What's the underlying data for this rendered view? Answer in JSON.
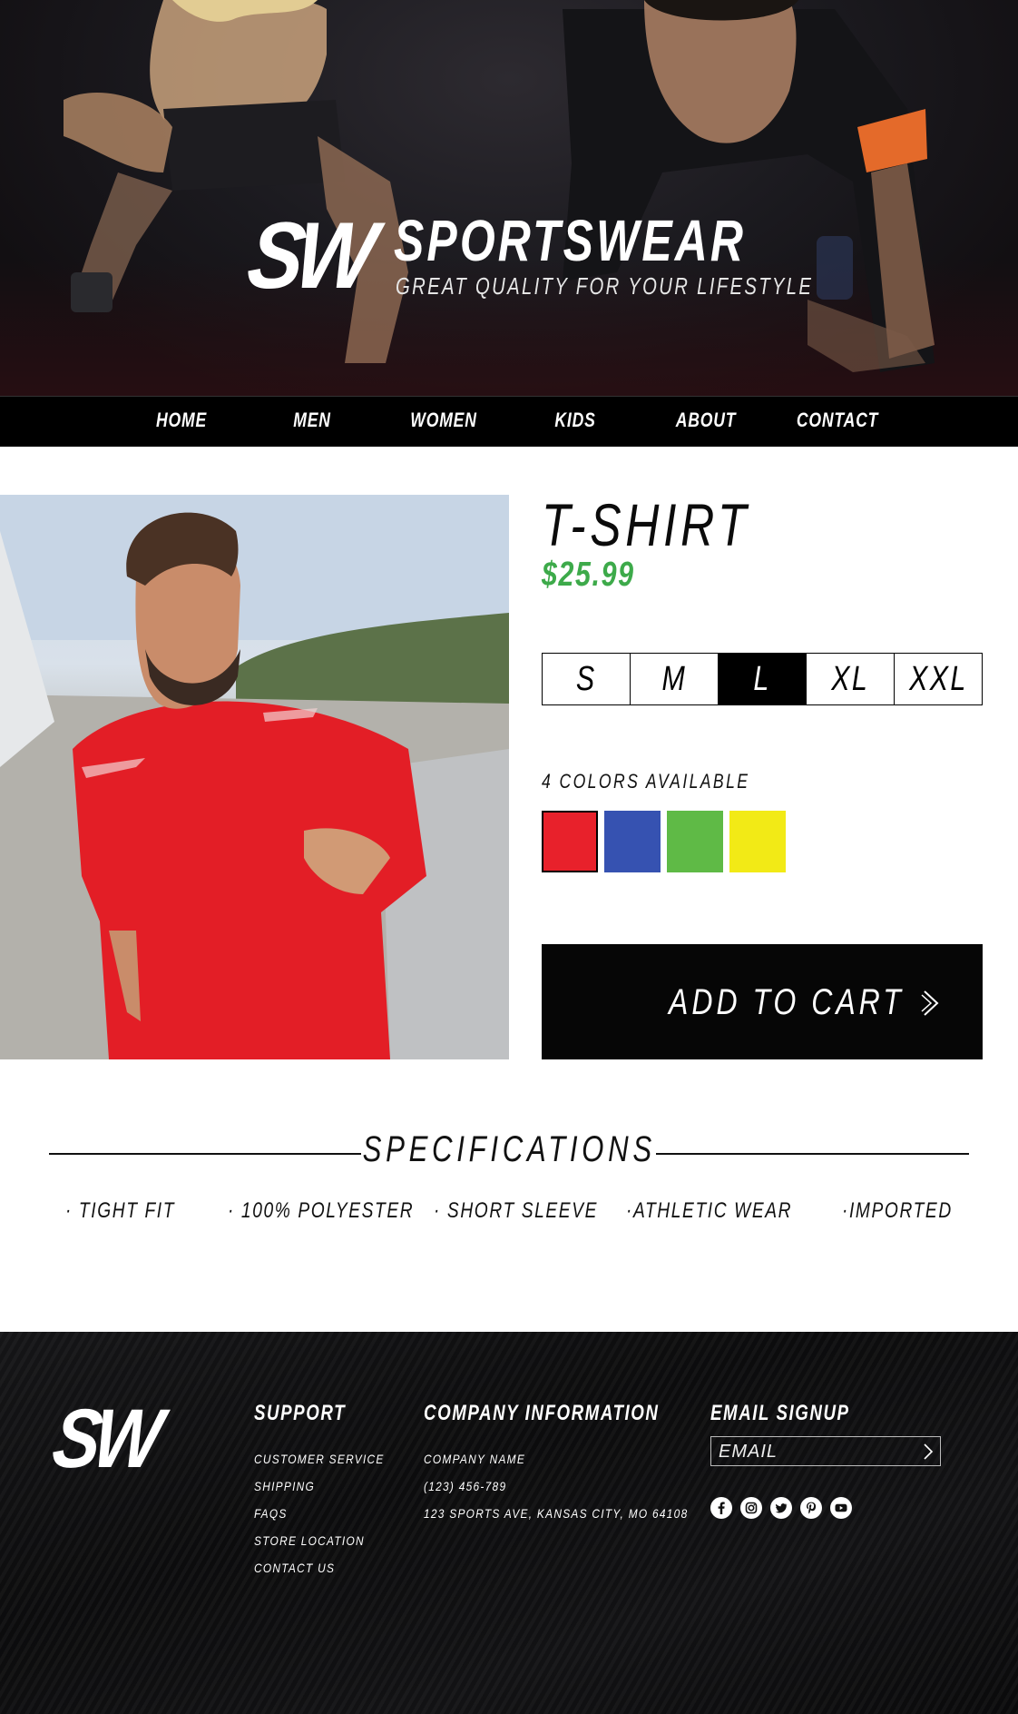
{
  "hero": {
    "logo_mark": "SW",
    "brand_name": "SPORTSWEAR",
    "tagline": "GREAT QUALITY FOR YOUR LIFESTYLE"
  },
  "nav": {
    "items": [
      "HOME",
      "MEN",
      "WOMEN",
      "KIDS",
      "ABOUT",
      "CONTACT"
    ]
  },
  "product": {
    "title": "T-SHIRT",
    "price": "$25.99",
    "sizes": [
      "S",
      "M",
      "L",
      "XL",
      "XXL"
    ],
    "selected_size": "L",
    "colors_label": "4 COLORS AVAILABLE",
    "colors": [
      "#e8212b",
      "#3652b1",
      "#5fba46",
      "#f2ea16"
    ],
    "selected_color": "#e8212b",
    "add_to_cart": "ADD TO CART"
  },
  "specifications": {
    "title": "SPECIFICATIONS",
    "items": [
      "· TIGHT FIT",
      "· 100% POLYESTER",
      "· SHORT SLEEVE",
      "·ATHLETIC WEAR",
      "·IMPORTED"
    ]
  },
  "footer": {
    "logo_mark": "SW",
    "support": {
      "heading": "SUPPORT",
      "links": [
        "CUSTOMER SERVICE",
        "SHIPPING",
        "FAQS",
        "STORE LOCATION",
        "CONTACT US"
      ]
    },
    "company": {
      "heading": "COMPANY INFORMATION",
      "lines": [
        "COMPANY NAME",
        "(123) 456-789",
        "123 SPORTS AVE, KANSAS CITY, MO 64108"
      ]
    },
    "email": {
      "heading": "EMAIL SIGNUP",
      "placeholder": "EMAIL"
    },
    "social_icons": [
      "facebook-icon",
      "instagram-icon",
      "twitter-icon",
      "pinterest-icon",
      "youtube-icon"
    ]
  }
}
